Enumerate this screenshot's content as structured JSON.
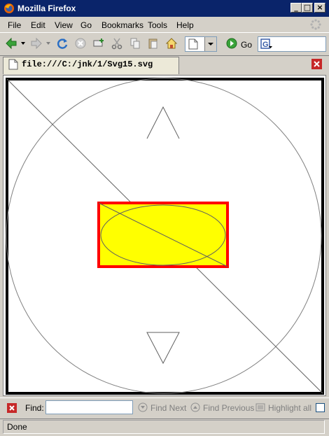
{
  "window": {
    "title": "Mozilla Firefox",
    "controls": [
      "_",
      "□",
      "×"
    ]
  },
  "menu": {
    "items": [
      {
        "label": "File",
        "accel": "F"
      },
      {
        "label": "Edit",
        "accel": "E"
      },
      {
        "label": "View",
        "accel": "V"
      },
      {
        "label": "Go",
        "accel": "G"
      },
      {
        "label": "Bookmarks",
        "accel": "B"
      },
      {
        "label": "Tools",
        "accel": "T"
      },
      {
        "label": "Help",
        "accel": "H"
      }
    ]
  },
  "toolbar": {
    "go_label": "Go"
  },
  "tab": {
    "label": "file:///C:/jnk/1/Svg15.svg"
  },
  "findbar": {
    "label": "Find:",
    "input_value": "",
    "find_next": "Find Next",
    "find_previous": "Find Previous",
    "highlight_all": "Highlight all"
  },
  "status": {
    "text": "Done"
  },
  "colors": {
    "titlebar": "#0a246a",
    "rect_fill": "#ffff00",
    "rect_stroke": "#ff0000",
    "frame_stroke": "#000000"
  },
  "icons": [
    "firefox-logo-icon",
    "throbber-icon",
    "back-icon",
    "forward-icon",
    "reload-icon",
    "stop-icon",
    "new-window-icon",
    "cut-icon",
    "copy-icon",
    "paste-icon",
    "home-icon",
    "page-icon",
    "go-icon",
    "search-engine-icon",
    "document-icon",
    "close-tab-icon",
    "close-findbar-icon",
    "find-next-icon",
    "find-previous-icon",
    "highlight-icon"
  ]
}
